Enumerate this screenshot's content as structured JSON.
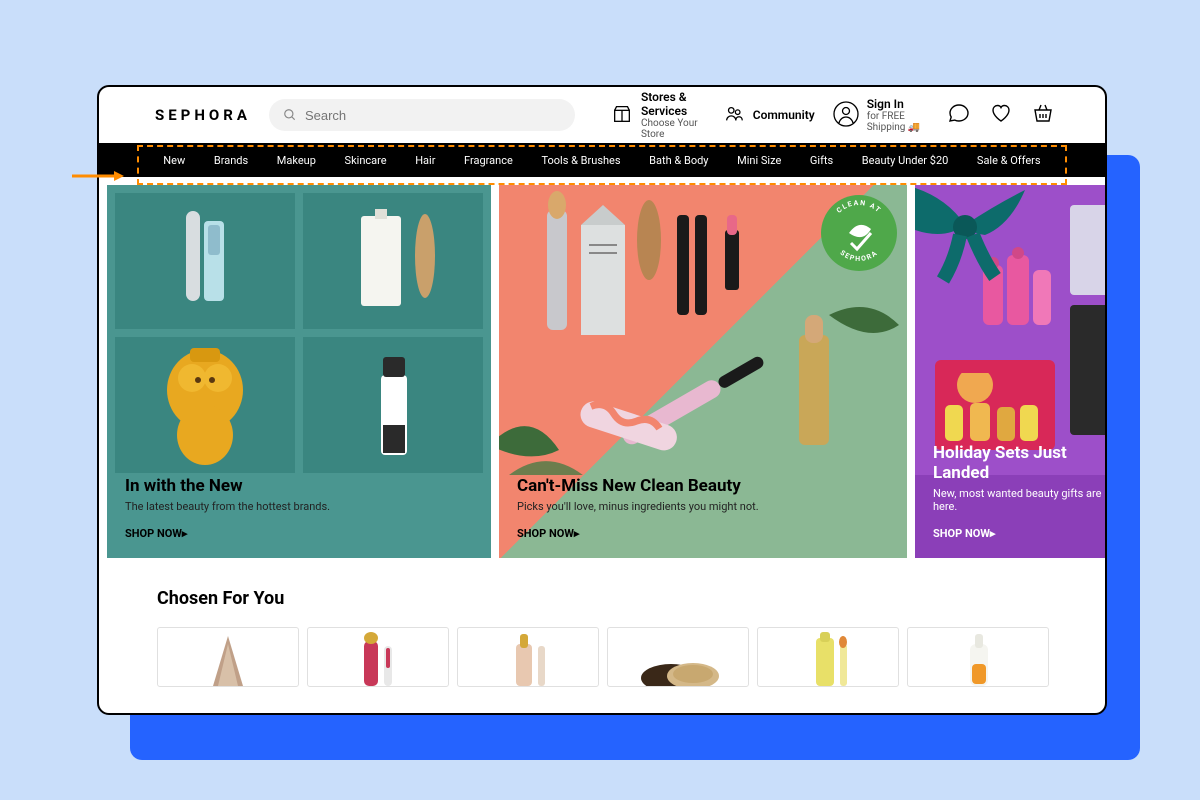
{
  "brand": "SEPHORA",
  "search": {
    "placeholder": "Search"
  },
  "header": {
    "stores": {
      "title": "Stores & Services",
      "subtitle": "Choose Your Store"
    },
    "community": {
      "label": "Community"
    },
    "signin": {
      "title": "Sign In",
      "subtitle": "for FREE Shipping 🚚"
    }
  },
  "nav": [
    "New",
    "Brands",
    "Makeup",
    "Skincare",
    "Hair",
    "Fragrance",
    "Tools & Brushes",
    "Bath & Body",
    "Mini Size",
    "Gifts",
    "Beauty Under $20",
    "Sale & Offers"
  ],
  "hero": [
    {
      "title": "In with the New",
      "subtitle": "The latest beauty from the hottest brands.",
      "cta": "SHOP NOW▸"
    },
    {
      "title": "Can't-Miss New Clean Beauty",
      "subtitle": "Picks you'll love, minus ingredients you might not.",
      "cta": "SHOP NOW▸",
      "badge_top": "CLEAN AT",
      "badge_bottom": "SEPHORA"
    },
    {
      "title": "Holiday Sets Just Landed",
      "subtitle": "New, most wanted beauty gifts are here.",
      "cta": "SHOP NOW▸"
    }
  ],
  "chosen": {
    "title": "Chosen For You"
  },
  "colors": {
    "teal": "#4a9690",
    "teal_dark": "#3a8680",
    "coral": "#f2856e",
    "sage": "#8bb894",
    "purple": "#8b3fb8",
    "green_badge": "#4fa84a",
    "annotation": "#ff8c00",
    "blue_accent": "#2563ff"
  }
}
